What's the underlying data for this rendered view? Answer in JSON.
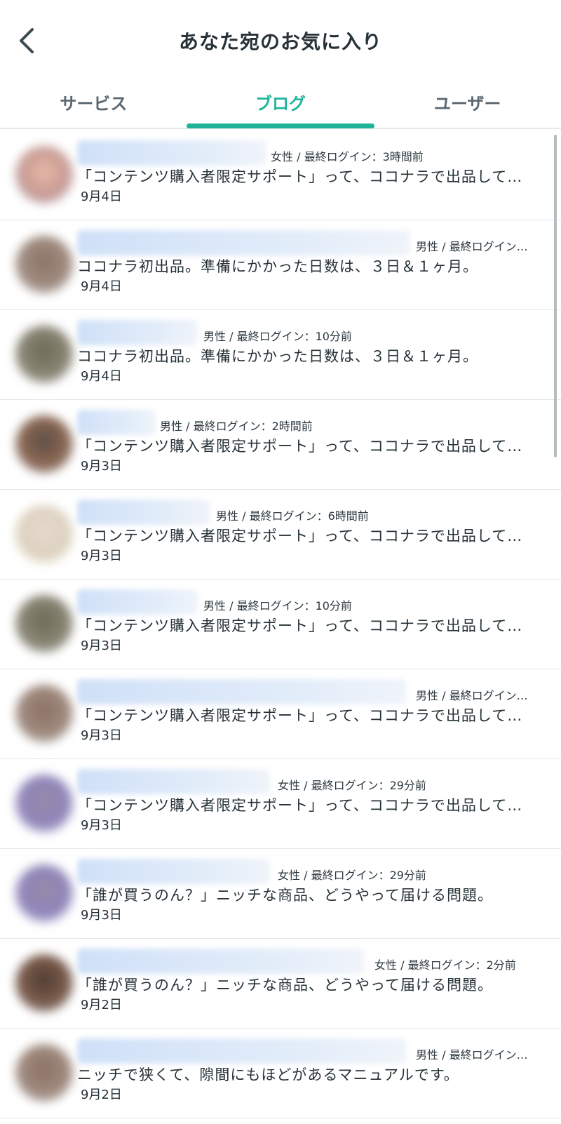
{
  "header": {
    "title": "あなた宛のお気に入り"
  },
  "tabs": [
    {
      "label": "サービス",
      "active": false
    },
    {
      "label": "ブログ",
      "active": true
    },
    {
      "label": "ユーザー",
      "active": false
    }
  ],
  "colors": {
    "accent": "#1fb49a",
    "text": "#263238"
  },
  "items": [
    {
      "meta": "女性 / 最終ログイン：3時間前",
      "title": "「コンテンツ購入者限定サポート」って、ココナラで出品して…",
      "date": "9月4日"
    },
    {
      "meta": "男性 / 最終ログイン…",
      "title": "ココナラ初出品。準備にかかった日数は、３日＆１ヶ月。",
      "date": "9月4日"
    },
    {
      "meta": "男性 / 最終ログイン：10分前",
      "title": "ココナラ初出品。準備にかかった日数は、３日＆１ヶ月。",
      "date": "9月4日"
    },
    {
      "meta": "男性 / 最終ログイン：2時間前",
      "title": "「コンテンツ購入者限定サポート」って、ココナラで出品して…",
      "date": "9月3日"
    },
    {
      "meta": "男性 / 最終ログイン：6時間前",
      "title": "「コンテンツ購入者限定サポート」って、ココナラで出品して…",
      "date": "9月3日"
    },
    {
      "meta": "男性 / 最終ログイン：10分前",
      "title": "「コンテンツ購入者限定サポート」って、ココナラで出品して…",
      "date": "9月3日"
    },
    {
      "meta": "男性 / 最終ログイン…",
      "title": "「コンテンツ購入者限定サポート」って、ココナラで出品して…",
      "date": "9月3日"
    },
    {
      "meta": "女性 / 最終ログイン：29分前",
      "title": "「コンテンツ購入者限定サポート」って、ココナラで出品して…",
      "date": "9月3日"
    },
    {
      "meta": "女性 / 最終ログイン：29分前",
      "title": "「誰が買うのん？」ニッチな商品、どうやって届ける問題。",
      "date": "9月3日"
    },
    {
      "meta": "女性 / 最終ログイン：2分前",
      "title": "「誰が買うのん？」ニッチな商品、どうやって届ける問題。",
      "date": "9月2日"
    },
    {
      "meta": "男性 / 最終ログイン…",
      "title": "ニッチで狭くて、隙間にもほどがあるマニュアルです。",
      "date": "9月2日"
    }
  ]
}
